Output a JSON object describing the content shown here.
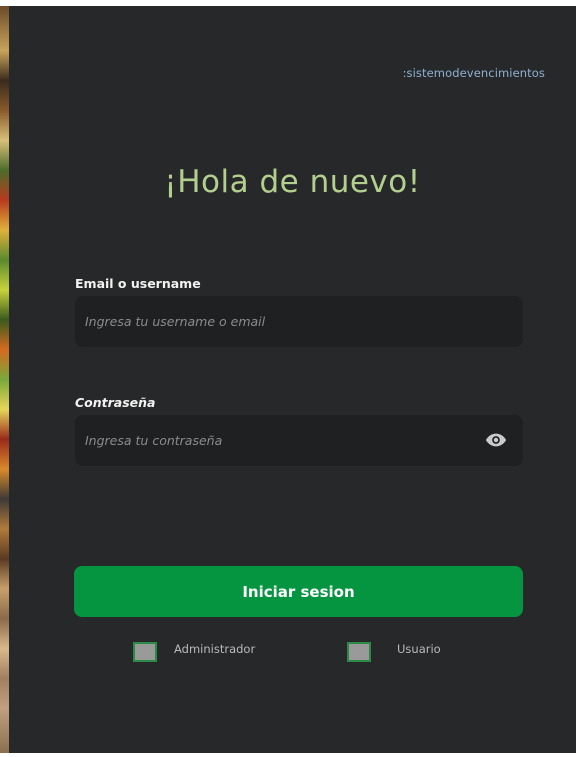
{
  "brand": ":sistemodevencimientos",
  "heading": "¡Hola de nuevo!",
  "email_field": {
    "label": "Email o username",
    "placeholder": "Ingresa tu username o email"
  },
  "password_field": {
    "label": "Contraseña",
    "placeholder": "Ingresa tu contraseña",
    "toggle_icon": "eye-icon"
  },
  "login_button": "Iniciar sesion",
  "roles": [
    {
      "label": "Administrador",
      "checked": false
    },
    {
      "label": "Usuario",
      "checked": false
    }
  ],
  "colors": {
    "panel": "#272829",
    "field": "#1f2021",
    "heading": "#b3cf8e",
    "brand": "#8fb0d4",
    "button": "#059541"
  }
}
